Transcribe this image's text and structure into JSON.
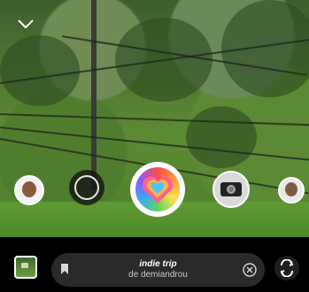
{
  "camera": {
    "close_icon": "chevron-down-icon",
    "effect_name": "indie trip",
    "creator": "de demiandrou"
  },
  "controls": {
    "gallery_icon": "gallery-thumbnail",
    "bookmark_icon": "bookmark-icon",
    "clear_icon": "close-circle-icon",
    "flip_icon": "flip-camera-icon"
  }
}
